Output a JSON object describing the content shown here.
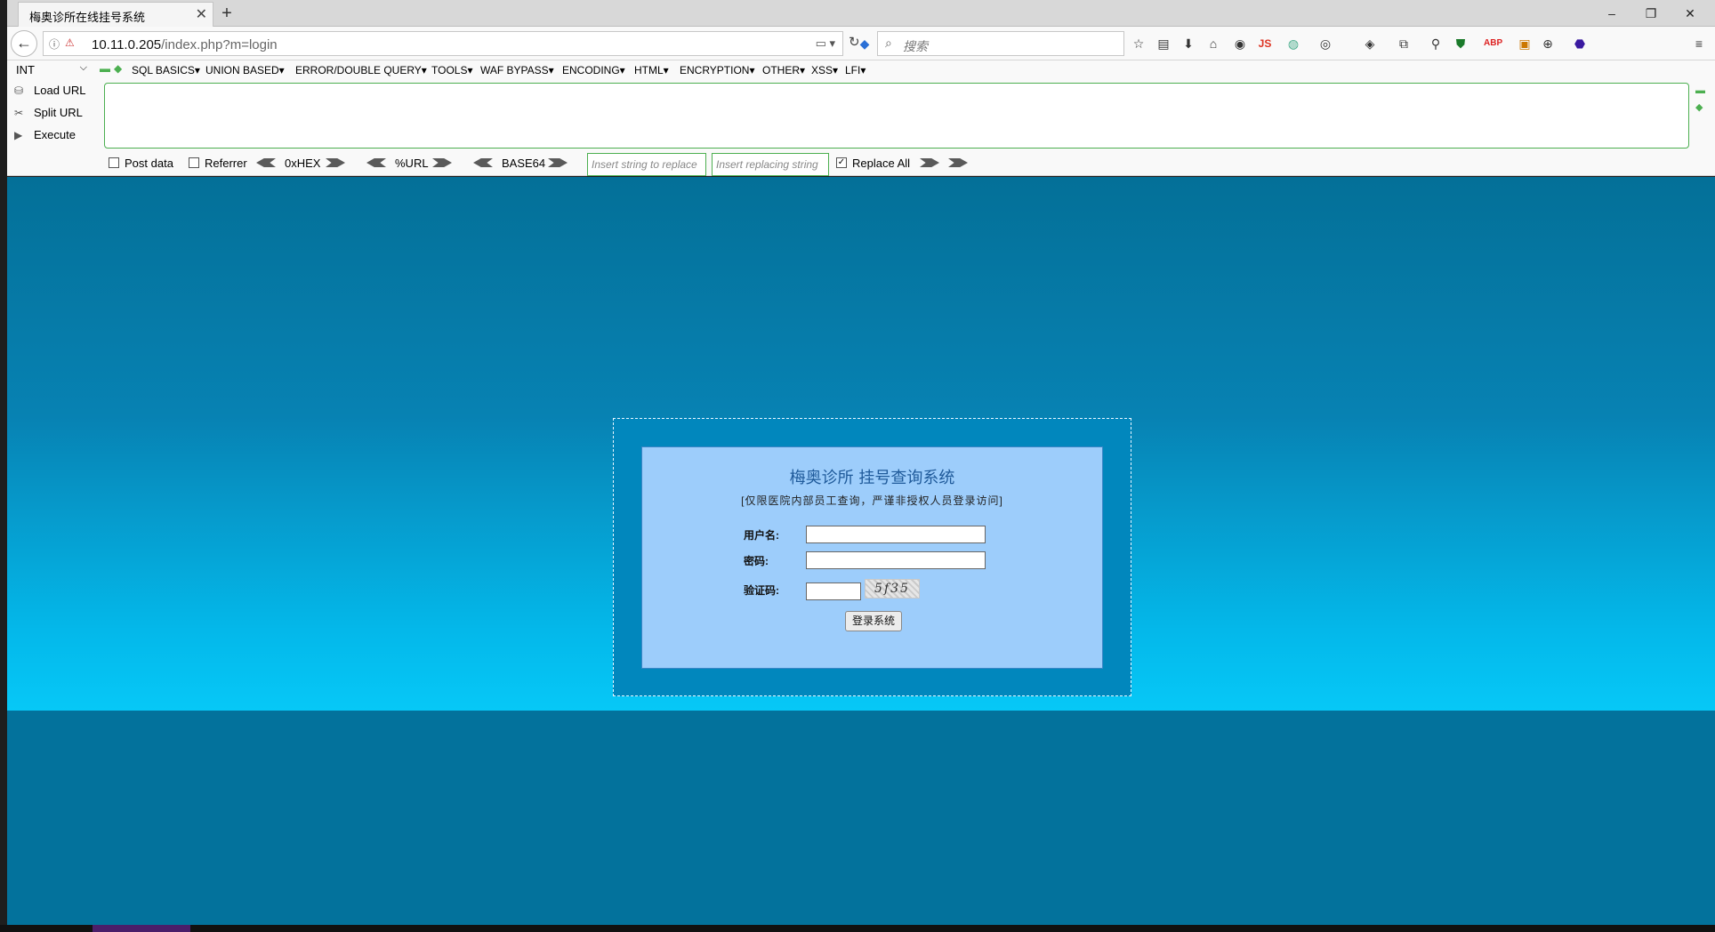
{
  "browser": {
    "tab_title": "梅奥诊所在线挂号系统",
    "tab_close": "✕",
    "new_tab": "+",
    "url_host": "10.11.0.205",
    "url_path": "/index.php?m=login",
    "search_placeholder": "搜索",
    "window_controls": [
      "–",
      "❐",
      "✕"
    ]
  },
  "hackbar": {
    "select_value": "INT",
    "menu": [
      "SQL BASICS▾",
      "UNION BASED▾",
      "ERROR/DOUBLE QUERY▾",
      "TOOLS▾",
      "WAF BYPASS▾",
      "ENCODING▾",
      "HTML▾",
      "ENCRYPTION▾",
      "OTHER▾",
      "XSS▾",
      "LFI▾"
    ],
    "actions": [
      "Load URL",
      "Split URL",
      "Execute"
    ],
    "post_data": "Post data",
    "referrer": "Referrer",
    "hex": "0xHEX",
    "url": "%URL",
    "base64": "BASE64",
    "replace_placeholder": "Insert string to replace",
    "replacing_placeholder": "Insert replacing string",
    "replace_all": "Replace All"
  },
  "login": {
    "title": "梅奥诊所 挂号查询系统",
    "subtitle": "[仅限医院内部员工查询，严谨非授权人员登录访问]",
    "username_label": "用户名:",
    "password_label": "密码:",
    "captcha_label": "验证码:",
    "captcha_text": "5f35",
    "submit_label": "登录系统"
  },
  "colors": {
    "page_bg": "#03729c",
    "login_panel": "#9dcdfb",
    "hackbar_border": "#4caf50"
  }
}
